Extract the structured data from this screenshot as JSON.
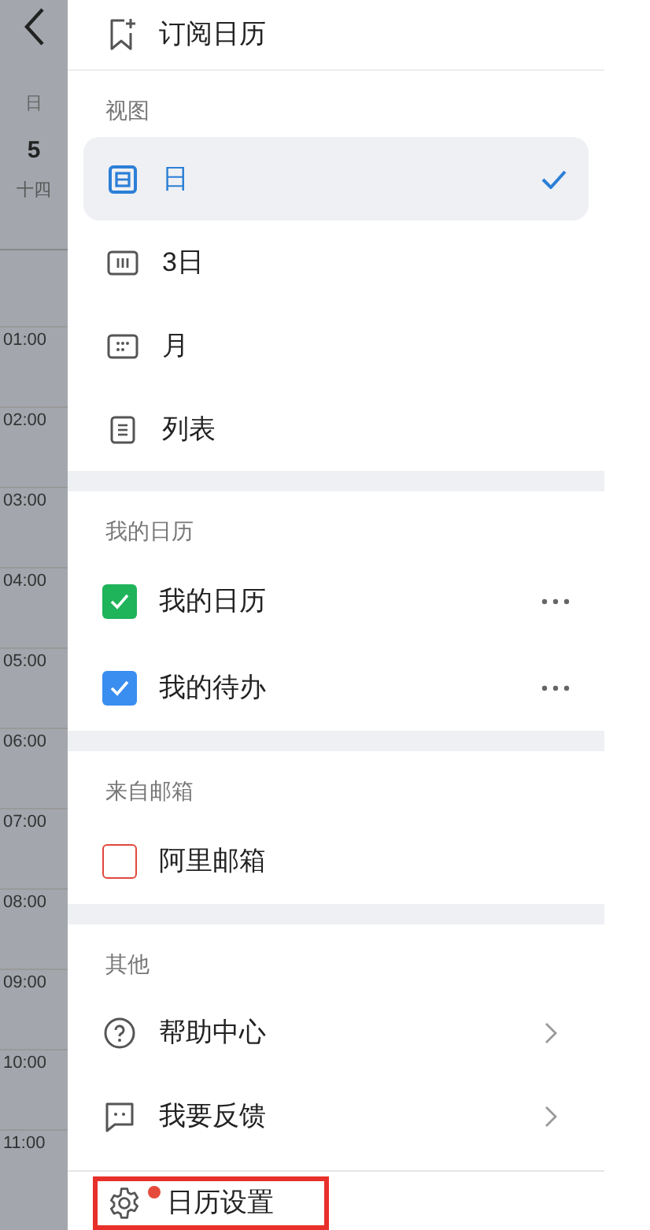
{
  "side_strip": {
    "weekday": "日",
    "date": "5",
    "lunar": "十四",
    "times": [
      "01:00",
      "02:00",
      "03:00",
      "04:00",
      "05:00",
      "06:00",
      "07:00",
      "08:00",
      "09:00",
      "10:00",
      "11:00"
    ]
  },
  "subscribe": {
    "label": "订阅日历"
  },
  "sections": [
    {
      "title": "视图",
      "items": [
        {
          "kind": "view",
          "label": "日",
          "selected": true
        },
        {
          "kind": "view",
          "label": "3日",
          "selected": false
        },
        {
          "kind": "view",
          "label": "月",
          "selected": false
        },
        {
          "kind": "view",
          "label": "列表",
          "selected": false
        }
      ]
    },
    {
      "title": "我的日历",
      "items": [
        {
          "kind": "calendar",
          "label": "我的日历",
          "checked": true,
          "color": "#1fb35a"
        },
        {
          "kind": "calendar",
          "label": "我的待办",
          "checked": true,
          "color": "#3a8ef0"
        }
      ]
    },
    {
      "title": "来自邮箱",
      "items": [
        {
          "kind": "calendar",
          "label": "阿里邮箱",
          "checked": false,
          "color": "#e0473c"
        }
      ]
    },
    {
      "title": "其他",
      "items": [
        {
          "kind": "link",
          "label": "帮助中心"
        },
        {
          "kind": "link",
          "label": "我要反馈"
        }
      ]
    }
  ],
  "settings": {
    "label": "日历设置",
    "badge": true,
    "highlighted": true
  }
}
